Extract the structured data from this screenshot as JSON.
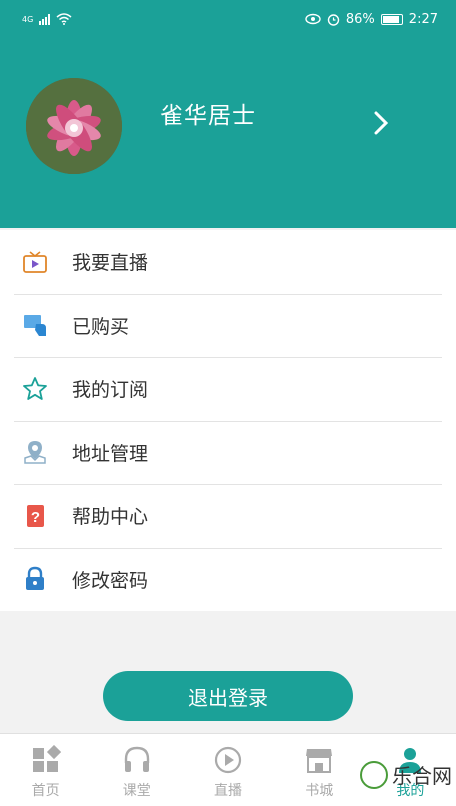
{
  "status_bar": {
    "network": "4G",
    "battery": "86%",
    "time": "2:27"
  },
  "profile": {
    "username": "雀华居士"
  },
  "menu": [
    {
      "label": "我要直播",
      "icon": "tv-icon"
    },
    {
      "label": "已购买",
      "icon": "purchased-icon"
    },
    {
      "label": "我的订阅",
      "icon": "star-icon"
    },
    {
      "label": "地址管理",
      "icon": "location-icon"
    },
    {
      "label": "帮助中心",
      "icon": "help-icon"
    },
    {
      "label": "修改密码",
      "icon": "lock-icon"
    }
  ],
  "logout_label": "退出登录",
  "tabbar": [
    {
      "label": "首页",
      "icon": "home-grid-icon",
      "active": false
    },
    {
      "label": "课堂",
      "icon": "headphones-icon",
      "active": false
    },
    {
      "label": "直播",
      "icon": "play-icon",
      "active": false
    },
    {
      "label": "书城",
      "icon": "store-icon",
      "active": false
    },
    {
      "label": "我的",
      "icon": "person-icon",
      "active": true
    }
  ],
  "watermark": "乐合网",
  "colors": {
    "accent": "#1ba198",
    "text": "#333333",
    "inactive": "#aaaaaa"
  }
}
